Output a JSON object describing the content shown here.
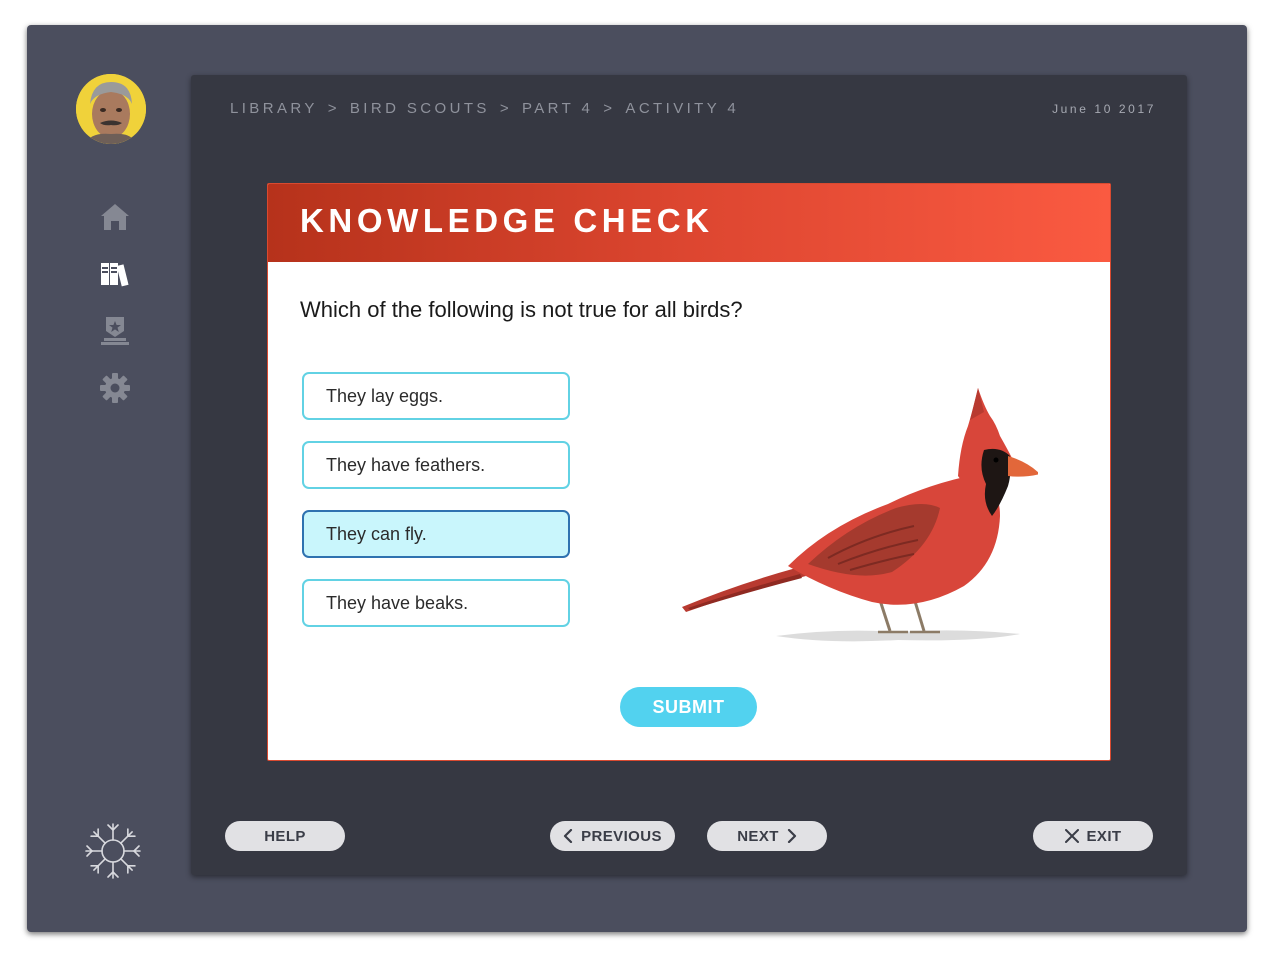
{
  "breadcrumb": {
    "items": [
      "LIBRARY",
      "BIRD SCOUTS",
      "PART 4",
      "ACTIVITY 4"
    ],
    "separator": ">"
  },
  "date": "June 10 2017",
  "sidebar": {
    "items": [
      {
        "icon": "home-icon",
        "active": false
      },
      {
        "icon": "library-icon",
        "active": true
      },
      {
        "icon": "badge-icon",
        "active": false
      },
      {
        "icon": "gear-icon",
        "active": false
      }
    ],
    "logo_icon": "snowflake-icon"
  },
  "card": {
    "title": "KNOWLEDGE CHECK",
    "question": "Which of the following is not true for all birds?",
    "options": [
      {
        "label": "They lay eggs.",
        "selected": false
      },
      {
        "label": "They have feathers.",
        "selected": false
      },
      {
        "label": "They can fly.",
        "selected": true
      },
      {
        "label": "They have beaks.",
        "selected": false
      }
    ],
    "submit_label": "SUBMIT"
  },
  "footer": {
    "help_label": "HELP",
    "previous_label": "PREVIOUS",
    "next_label": "NEXT",
    "exit_label": "EXIT"
  },
  "colors": {
    "frame": "#4b4e5e",
    "panel": "#363842",
    "header_gradient_start": "#b6321b",
    "header_gradient_end": "#fa5a41",
    "option_border": "#62d2e4",
    "option_selected_bg": "#c9f6fc",
    "option_selected_border": "#2f72b0",
    "submit": "#52d2ef",
    "footer_button": "#e1e1e4"
  }
}
